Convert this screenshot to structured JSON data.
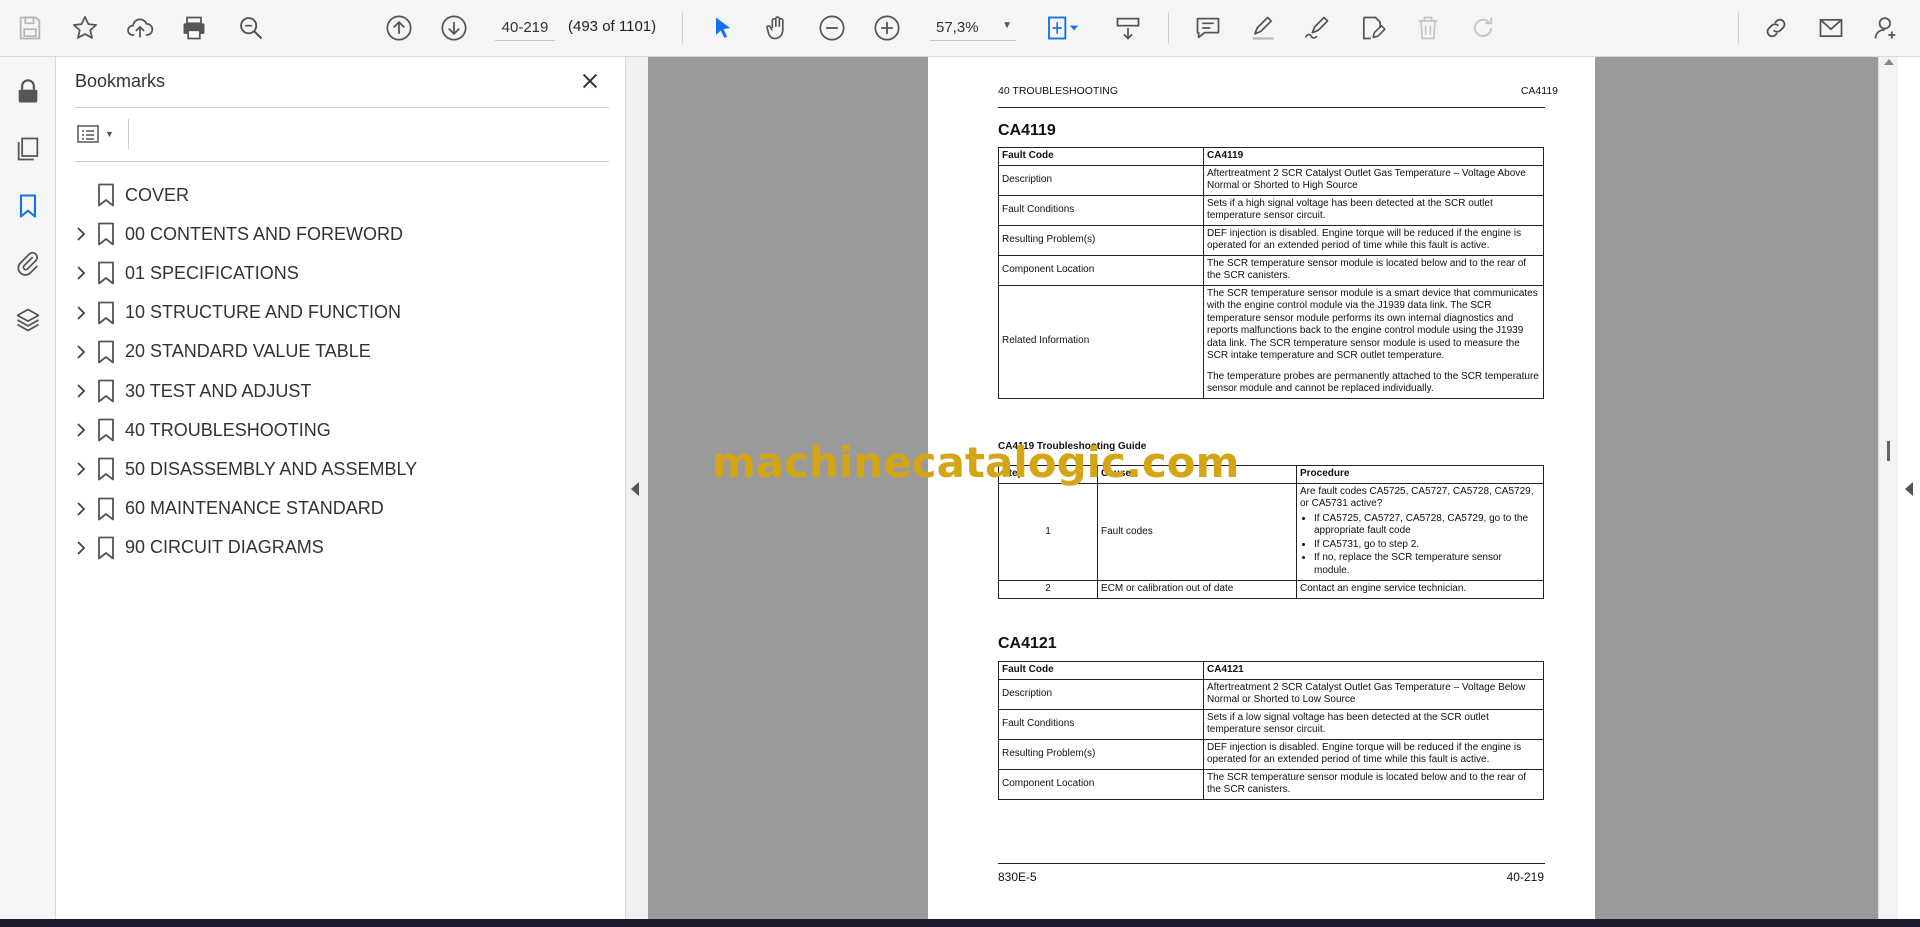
{
  "toolbar": {
    "page_input_value": "40-219",
    "page_count": "(493 of 1101)",
    "zoom_value": "57,3%"
  },
  "bookmarks_panel": {
    "title": "Bookmarks",
    "items": [
      {
        "label": "COVER",
        "expandable": false
      },
      {
        "label": "00 CONTENTS AND FOREWORD",
        "expandable": true
      },
      {
        "label": "01 SPECIFICATIONS",
        "expandable": true
      },
      {
        "label": "10 STRUCTURE AND FUNCTION",
        "expandable": true
      },
      {
        "label": "20 STANDARD VALUE TABLE",
        "expandable": true
      },
      {
        "label": "30 TEST AND ADJUST",
        "expandable": true
      },
      {
        "label": "40 TROUBLESHOOTING",
        "expandable": true
      },
      {
        "label": "50 DISASSEMBLY AND ASSEMBLY",
        "expandable": true
      },
      {
        "label": "60 MAINTENANCE STANDARD",
        "expandable": true
      },
      {
        "label": "90 CIRCUIT DIAGRAMS",
        "expandable": true
      }
    ]
  },
  "document": {
    "header_left": "40 TROUBLESHOOTING",
    "header_right": "CA4119",
    "section1": {
      "heading": "CA4119",
      "head_key": "Fault Code",
      "head_value": "CA4119",
      "rows": [
        {
          "key": "Description",
          "value": "Aftertreatment 2 SCR Catalyst Outlet Gas Temperature – Voltage Above Normal or Shorted to High Source"
        },
        {
          "key": "Fault Conditions",
          "value": "Sets if a high signal voltage has been detected at the SCR outlet temperature sensor circuit."
        },
        {
          "key": "Resulting Problem(s)",
          "value": "DEF injection is disabled. Engine torque will be reduced if the engine is operated for an extended period of time while this fault is active."
        },
        {
          "key": "Component Location",
          "value": "The SCR temperature sensor module is located below and to the rear of the SCR canisters."
        }
      ],
      "related_key": "Related Information",
      "related_p1": "The SCR temperature sensor module is a smart device that communicates with the engine control module via the J1939 data link. The SCR temperature sensor module performs its own internal diagnostics and reports malfunctions back to the engine control module using the J1939 data link. The SCR temperature sensor module is used to measure the SCR intake temperature and SCR outlet temperature.",
      "related_p2": "The temperature probes are permanently attached to the SCR temperature sensor module and cannot be replaced individually."
    },
    "guide": {
      "caption": "CA4119 Troubleshooting Guide",
      "col_step": "Step",
      "col_cause": "Cause",
      "col_procedure": "Procedure",
      "row1_step": "1",
      "row1_cause": "Fault codes",
      "row1_intro": "Are fault codes CA5725, CA5727, CA5728, CA5729, or CA5731 active?",
      "row1_bullet1": "If CA5725, CA5727, CA5728, CA5729, go to the appropriate fault code",
      "row1_bullet2": "If CA5731, go to step 2.",
      "row1_bullet3": "If no, replace the SCR temperature sensor module.",
      "row2_step": "2",
      "row2_cause": "ECM or calibration out of date",
      "row2_procedure": "Contact an engine service technician."
    },
    "section2": {
      "heading": "CA4121",
      "head_key": "Fault Code",
      "head_value": "CA4121",
      "rows": [
        {
          "key": "Description",
          "value": "Aftertreatment 2 SCR Catalyst Outlet Gas Temperature – Voltage Below Normal or Shorted to Low Source"
        },
        {
          "key": "Fault Conditions",
          "value": "Sets if a low signal voltage has been detected at the SCR outlet temperature sensor circuit."
        },
        {
          "key": "Resulting Problem(s)",
          "value": "DEF injection is disabled. Engine torque will be reduced if the engine is operated for an extended period of time while this fault is active."
        },
        {
          "key": "Component Location",
          "value": "The SCR temperature sensor module is located below and to the rear of the SCR canisters."
        }
      ]
    },
    "footer_left": "830E-5",
    "footer_right": "40-219"
  },
  "watermark": "machinecatalogic.com",
  "colors": {
    "accent_blue": "#1473e6",
    "icon_gray": "#555555",
    "watermark": "#d4a514"
  }
}
